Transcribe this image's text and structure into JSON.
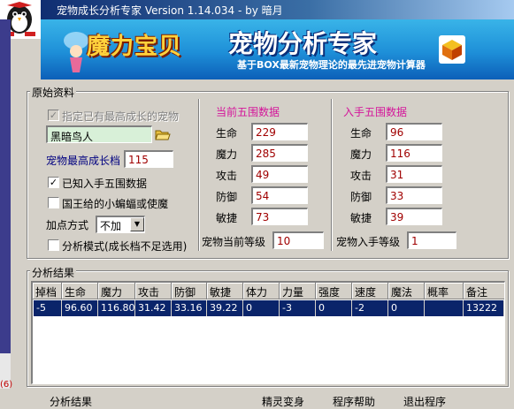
{
  "window": {
    "title": "宠物成长分析专家  Version 1.14.034 - by 暗月"
  },
  "banner": {
    "logo_text": "魔力宝贝",
    "heading": "宠物分析专家",
    "tagline": "基于BOX最新宠物理论的最先进宠物计算器"
  },
  "raw": {
    "legend": "原始资料",
    "specify_max_label": "指定已有最高成长的宠物",
    "specify_max_checked": true,
    "pet_name": "黑暗鸟人",
    "max_growth_label": "宠物最高成长档",
    "max_growth_value": "115",
    "known_stats_label": "已知入手五围数据",
    "known_stats_checked": true,
    "king_bat_label": "国王给的小蝙蝠或使魔",
    "king_bat_checked": false,
    "points_label": "加点方式",
    "points_value": "不加",
    "analysis_mode_label": "分析模式(成长档不足选用)",
    "analysis_mode_checked": false
  },
  "current": {
    "heading": "当前五围数据",
    "stats": [
      {
        "label": "生命",
        "value": "229"
      },
      {
        "label": "魔力",
        "value": "285"
      },
      {
        "label": "攻击",
        "value": "49"
      },
      {
        "label": "防御",
        "value": "54"
      },
      {
        "label": "敏捷",
        "value": "73"
      }
    ],
    "level_label": "宠物当前等级",
    "level_value": "10"
  },
  "initial": {
    "heading": "入手五围数据",
    "stats": [
      {
        "label": "生命",
        "value": "96"
      },
      {
        "label": "魔力",
        "value": "116"
      },
      {
        "label": "攻击",
        "value": "31"
      },
      {
        "label": "防御",
        "value": "33"
      },
      {
        "label": "敏捷",
        "value": "39"
      }
    ],
    "level_label": "宠物入手等级",
    "level_value": "1"
  },
  "results": {
    "legend": "分析结果",
    "columns": [
      "掉档",
      "生命",
      "魔力",
      "攻击",
      "防御",
      "敏捷",
      "体力",
      "力量",
      "强度",
      "速度",
      "魔法",
      "概率",
      "备注"
    ],
    "rows": [
      [
        "-5",
        "96.60",
        "116.80",
        "31.42",
        "33.16",
        "39.22",
        "0",
        "-3",
        "0",
        "-2",
        "0",
        "",
        "13222"
      ]
    ]
  },
  "bottom_bar": {
    "items": [
      "分析结果",
      "精灵变身",
      "程序帮助",
      "退出程序"
    ]
  },
  "strip_fragment": "(6)",
  "colors": {
    "selection": "#0a246a",
    "section_heading": "#d4149a",
    "field_value": "#a00000",
    "banner_blue": "#1e8fd8"
  }
}
